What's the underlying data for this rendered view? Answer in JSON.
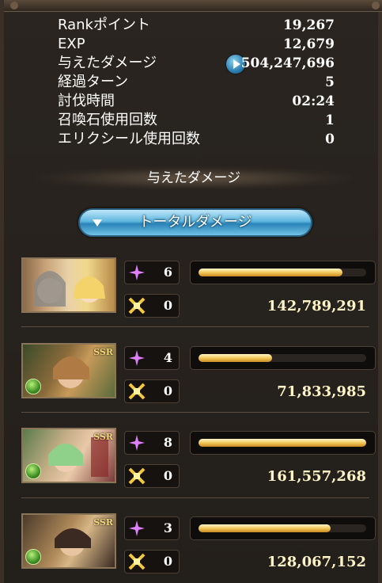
{
  "stats": [
    {
      "label": "Rankポイント",
      "value": "19,267"
    },
    {
      "label": "EXP",
      "value": "12,679"
    },
    {
      "label": "与えたダメージ",
      "value": "504,247,696"
    },
    {
      "label": "経過ターン",
      "value": "5"
    },
    {
      "label": "討伐時間",
      "value": "02:24"
    },
    {
      "label": "召喚石使用回数",
      "value": "1"
    },
    {
      "label": "エリクシール使用回数",
      "value": "0"
    }
  ],
  "section_title": "与えたダメージ",
  "dropdown": {
    "label": "トータルダメージ"
  },
  "characters": [
    {
      "name": "character-1",
      "rarity": "",
      "actions": "6",
      "criticals": "0",
      "damage": "142,789,291",
      "bar_fraction": 0.86
    },
    {
      "name": "character-2",
      "rarity": "SSR",
      "actions": "4",
      "criticals": "0",
      "damage": "71,833,985",
      "bar_fraction": 0.44
    },
    {
      "name": "character-3",
      "rarity": "SSR",
      "actions": "8",
      "criticals": "0",
      "damage": "161,557,268",
      "bar_fraction": 1.0
    },
    {
      "name": "character-4",
      "rarity": "SSR",
      "actions": "3",
      "criticals": "0",
      "damage": "128,067,152",
      "bar_fraction": 0.79
    }
  ],
  "colors": {
    "accent_blue": "#5fb7df",
    "bar_gold": "#f2c85a",
    "wind_element": "#3f8f24",
    "action_icon": "#e080ff"
  }
}
